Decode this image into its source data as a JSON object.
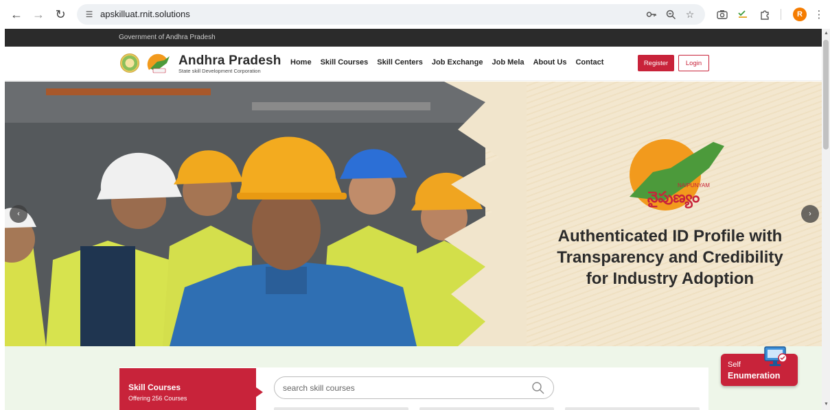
{
  "browser": {
    "url": "apskilluat.rnit.solutions",
    "profile_initial": "R"
  },
  "topbar": {
    "text": "Government of Andhra Pradesh"
  },
  "header": {
    "brand_title": "Andhra Pradesh",
    "brand_subtitle": "State skill Development Corporation",
    "nav": [
      "Home",
      "Skill Courses",
      "Skill Centers",
      "Job Exchange",
      "Job Mela",
      "About Us",
      "Contact"
    ],
    "register_label": "Register",
    "login_label": "Login"
  },
  "hero": {
    "headline_line1": "Authenticated ID Profile with",
    "headline_line2": "Transparency and Credibility",
    "headline_line3": "for Industry Adoption",
    "logo_caption": "NAIPUNYAM",
    "logo_telugu": "నైపుణ్యం"
  },
  "skill_courses": {
    "title": "Skill Courses",
    "subtitle": "Offering 256 Courses",
    "search_placeholder": "search skill courses"
  },
  "self_enumeration": {
    "line1": "Self",
    "line2": "Enumeration"
  },
  "colors": {
    "brand_red": "#c8233a",
    "topbar": "#2b2b2b",
    "lower_bg": "#eef6e9"
  }
}
